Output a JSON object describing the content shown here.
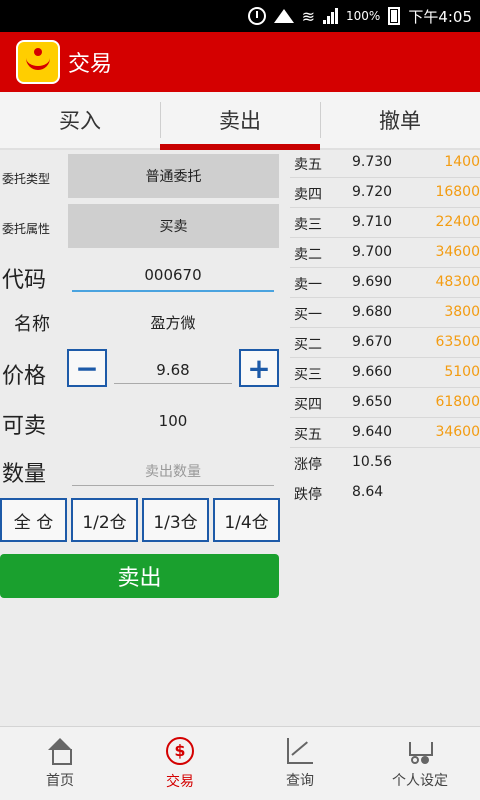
{
  "status_bar": {
    "time": "下午4:05",
    "battery": "100%",
    "network": "4G 2G"
  },
  "header": {
    "title": "交易"
  },
  "tabs": [
    {
      "label": "买入",
      "active": false
    },
    {
      "label": "卖出",
      "active": true
    },
    {
      "label": "撤单",
      "active": false
    }
  ],
  "form": {
    "order_type_label": "委托类型",
    "order_type_value": "普通委托",
    "order_attr_label": "委托属性",
    "order_attr_value": "买卖",
    "code_label": "代码",
    "code_value": "000670",
    "name_label": "名称",
    "name_value": "盈方微",
    "price_label": "价格",
    "price_value": "9.68",
    "sellable_label": "可卖",
    "sellable_value": "100",
    "qty_label": "数量",
    "qty_placeholder": "卖出数量",
    "position_buttons": [
      "全 仓",
      "1/2仓",
      "1/3仓",
      "1/4仓"
    ],
    "sell_button": "卖出"
  },
  "quotes": [
    {
      "name": "卖五",
      "price": "9.730",
      "volume": "1400"
    },
    {
      "name": "卖四",
      "price": "9.720",
      "volume": "16800"
    },
    {
      "name": "卖三",
      "price": "9.710",
      "volume": "22400"
    },
    {
      "name": "卖二",
      "price": "9.700",
      "volume": "34600"
    },
    {
      "name": "卖一",
      "price": "9.690",
      "volume": "48300"
    },
    {
      "name": "买一",
      "price": "9.680",
      "volume": "3800"
    },
    {
      "name": "买二",
      "price": "9.670",
      "volume": "63500"
    },
    {
      "name": "买三",
      "price": "9.660",
      "volume": "5100"
    },
    {
      "name": "买四",
      "price": "9.650",
      "volume": "61800"
    },
    {
      "name": "买五",
      "price": "9.640",
      "volume": "34600"
    }
  ],
  "limits": [
    {
      "name": "涨停",
      "price": "10.56"
    },
    {
      "name": "跌停",
      "price": "8.64"
    }
  ],
  "bottom_nav": [
    {
      "label": "首页",
      "icon": "home-icon",
      "active": false
    },
    {
      "label": "交易",
      "icon": "dollar-icon",
      "active": true
    },
    {
      "label": "查询",
      "icon": "chart-icon",
      "active": false
    },
    {
      "label": "个人设定",
      "icon": "cart-icon",
      "active": false
    }
  ],
  "colors": {
    "brand": "#d40000",
    "sell_button": "#1aa02e",
    "volume": "#f39c12",
    "accent_blue": "#1d5aa8"
  }
}
